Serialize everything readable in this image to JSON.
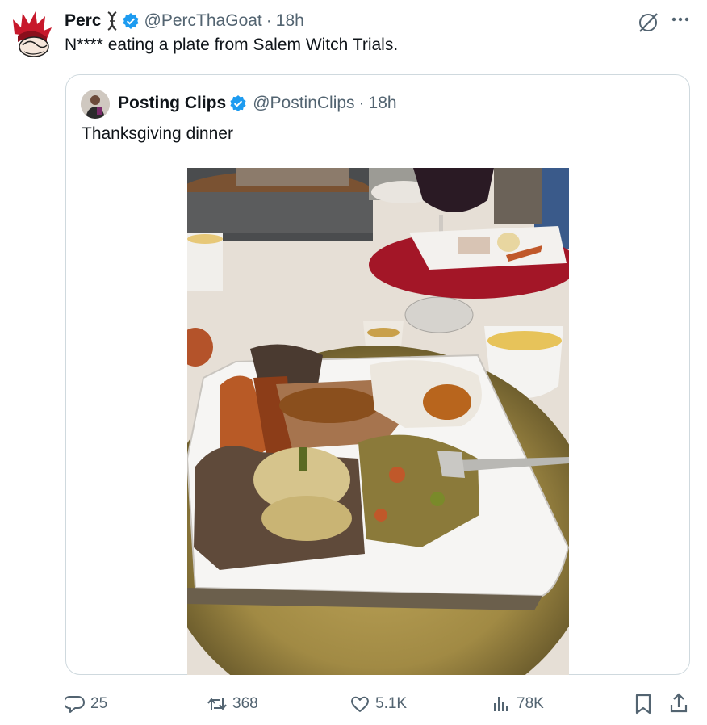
{
  "tweet": {
    "author": {
      "name": "Perc",
      "emoji_icon": "dna-emoji-icon",
      "verified": true,
      "handle": "@PercThaGoat",
      "separator": "·",
      "time": "18h"
    },
    "text": "N**** eating a plate from Salem Witch Trials.",
    "icons": {
      "avatar": "red-spiky-hair-anime-avatar",
      "grok": "grok-icon",
      "more": "more-dots-icon"
    },
    "quoted": {
      "author": {
        "name": "Posting Clips",
        "verified": true,
        "handle": "@PostinClips",
        "separator": "·",
        "time": "18h"
      },
      "text": "Thanksgiving dinner",
      "media": "photo-thanksgiving-plate"
    },
    "actions": {
      "replies": "25",
      "reposts": "368",
      "likes": "5.1K",
      "views": "78K"
    }
  },
  "colors": {
    "text": "#0f1419",
    "muted": "#536471",
    "verified": "#1d9bf0",
    "border": "#cfd9de"
  }
}
